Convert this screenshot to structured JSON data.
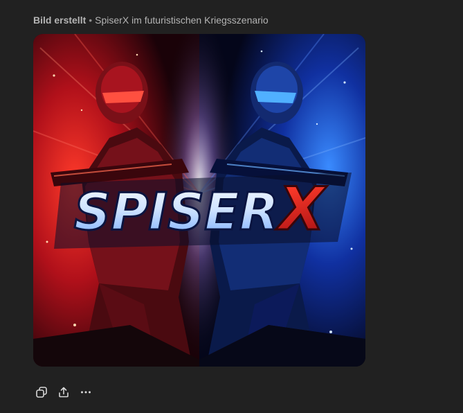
{
  "caption": {
    "status": "Bild erstellt",
    "separator": "•",
    "title": "SpiserX im futuristischen Kriegsszenario"
  },
  "image": {
    "logo_text": "SpiserX",
    "colors": {
      "left_glow": "#ff2a2a",
      "right_glow": "#1e6bff",
      "background": "#212121",
      "caption": "#b4b4b4"
    }
  },
  "toolbar": {
    "icons": [
      "copy-icon",
      "share-icon",
      "more-icon"
    ]
  }
}
